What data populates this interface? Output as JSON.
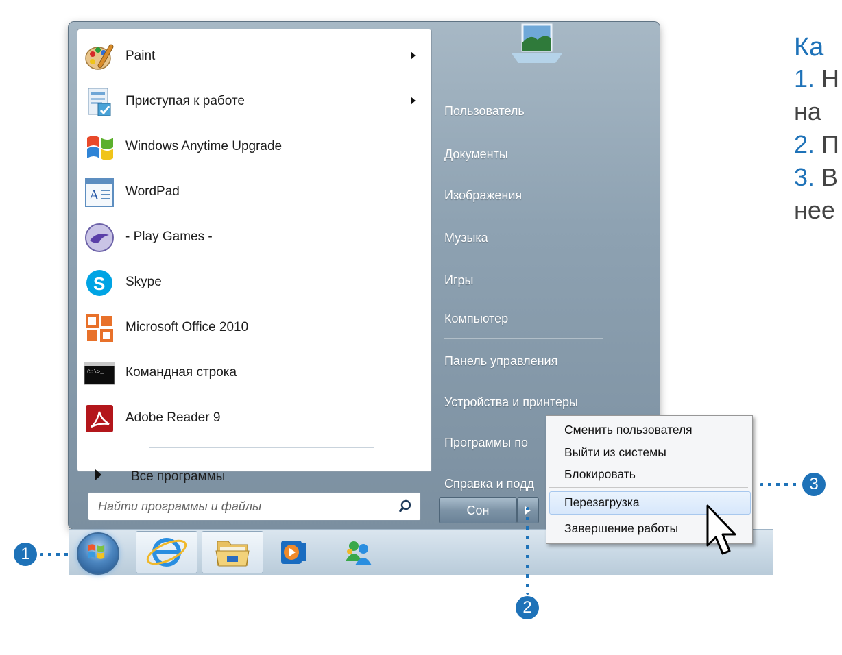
{
  "programs": [
    {
      "label": "Paint",
      "icon": "paint-icon",
      "has_submenu": true
    },
    {
      "label": "Приступая к работе",
      "icon": "getting-started-icon",
      "has_submenu": true
    },
    {
      "label": "Windows Anytime Upgrade",
      "icon": "windows-flag-icon",
      "has_submenu": false
    },
    {
      "label": "WordPad",
      "icon": "wordpad-icon",
      "has_submenu": false
    },
    {
      "label": "- Play Games -",
      "icon": "games-icon",
      "has_submenu": false
    },
    {
      "label": "Skype",
      "icon": "skype-icon",
      "has_submenu": false
    },
    {
      "label": "Microsoft Office 2010",
      "icon": "office-icon",
      "has_submenu": false
    },
    {
      "label": "Командная строка",
      "icon": "cmd-icon",
      "has_submenu": false
    },
    {
      "label": "Adobe Reader 9",
      "icon": "adobe-reader-icon",
      "has_submenu": false
    }
  ],
  "all_programs": "Все программы",
  "search": {
    "placeholder": "Найти программы и файлы"
  },
  "right_items": [
    "Пользователь",
    "Документы",
    "Изображения",
    "Музыка",
    "Игры",
    "Компьютер",
    "Панель управления",
    "Устройства и принтеры",
    "Программы по",
    "Справка и подд"
  ],
  "power": {
    "sleep_label": "Сон"
  },
  "context_menu": {
    "items": [
      "Сменить пользователя",
      "Выйти из системы",
      "Блокировать",
      "Перезагрузка",
      "Завершение работы"
    ],
    "highlighted": "Перезагрузка"
  },
  "taskbar": {
    "items": [
      "start-orb",
      "internet-explorer-icon",
      "explorer-folder-icon",
      "media-player-icon",
      "messenger-icon"
    ]
  },
  "callouts": {
    "one": "1",
    "two": "2",
    "three": "3"
  },
  "instructions": {
    "title": "Ка",
    "lines": [
      {
        "num": "1.",
        "text": "Н"
      },
      {
        "num": "",
        "text": "на"
      },
      {
        "num": "2.",
        "text": "П"
      },
      {
        "num": "3.",
        "text": "В"
      },
      {
        "num": "",
        "text": "нее"
      }
    ]
  },
  "colors": {
    "accent": "#1e72b8",
    "menu": "#8ea2b2",
    "taskbar": "#c6d6e3"
  }
}
